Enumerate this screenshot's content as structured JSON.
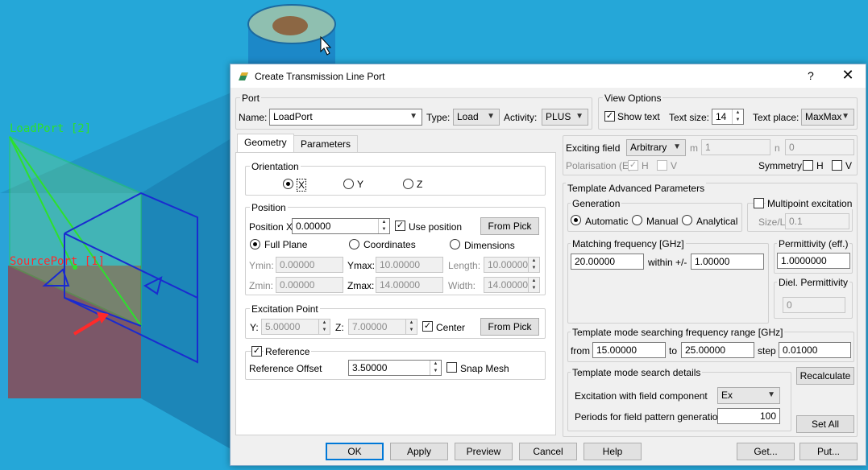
{
  "viewport": {
    "load_port_label": "LoadPort [2]",
    "source_port_label": "SourcePort [1]"
  },
  "dialog": {
    "title": "Create Transmission Line Port",
    "help": "?",
    "close": "✕"
  },
  "port": {
    "group_title": "Port",
    "name_label": "Name:",
    "name_value": "LoadPort",
    "type_label": "Type:",
    "type_value": "Load",
    "activity_label": "Activity:",
    "activity_value": "PLUS"
  },
  "view_options": {
    "group_title": "View Options",
    "show_text_label": "Show text",
    "show_text_checked": true,
    "text_size_label": "Text size:",
    "text_size_value": "14",
    "text_place_label": "Text place:",
    "text_place_value": "MaxMax"
  },
  "tabs": [
    "Geometry",
    "Parameters"
  ],
  "orientation": {
    "group_title": "Orientation",
    "options": [
      "X",
      "Y",
      "Z"
    ],
    "selected": "X"
  },
  "position": {
    "group_title": "Position",
    "position_x_label": "Position X",
    "position_x_value": "0.00000",
    "use_position_label": "Use position",
    "from_pick_label": "From Pick",
    "modes": [
      "Full Plane",
      "Coordinates",
      "Dimensions"
    ],
    "selected_mode": "Full Plane",
    "ymin_label": "Ymin:",
    "ymin_value": "0.00000",
    "ymax_label": "Ymax:",
    "ymax_value": "10.00000",
    "length_label": "Length:",
    "length_value": "10.00000",
    "zmin_label": "Zmin:",
    "zmin_value": "0.00000",
    "zmax_label": "Zmax:",
    "zmax_value": "14.00000",
    "width_label": "Width:",
    "width_value": "14.00000"
  },
  "excitation_point": {
    "group_title": "Excitation Point",
    "y_label": "Y:",
    "y_value": "5.00000",
    "z_label": "Z:",
    "z_value": "7.00000",
    "center_label": "Center",
    "from_pick_label": "From Pick"
  },
  "reference": {
    "group_title": "Reference",
    "offset_label": "Reference Offset",
    "offset_value": "3.50000",
    "snap_mesh_label": "Snap Mesh"
  },
  "exciting": {
    "field_label": "Exciting field",
    "field_value": "Arbitrary",
    "m_label": "m",
    "m_value": "1",
    "n_label": "n",
    "n_value": "0",
    "polarisation_label": "Polarisation (E)",
    "h_label": "H",
    "v_label": "V",
    "symmetry_label": "Symmetry",
    "sym_h_label": "H",
    "sym_v_label": "V"
  },
  "template": {
    "group_title": "Template Advanced Parameters",
    "generation_title": "Generation",
    "generation_options": [
      "Automatic",
      "Manual",
      "Analytical"
    ],
    "generation_selected": "Automatic",
    "multipoint_label": "Multipoint excitation",
    "size_l_label": "Size/L",
    "size_l_value": "0.1",
    "matching_title": "Matching frequency [GHz]",
    "matching_value": "20.00000",
    "within_label": "within +/-",
    "within_value": "1.00000",
    "permittivity_title": "Permittivity (eff.)",
    "permittivity_value": "1.0000000",
    "diel_title": "Diel. Permittivity",
    "diel_value": "0",
    "range_title": "Template mode searching frequency range [GHz]",
    "from_label": "from",
    "from_value": "15.00000",
    "to_label": "to",
    "to_value": "25.00000",
    "step_label": "step",
    "step_value": "0.01000",
    "search_title": "Template mode search details",
    "excitation_component_label": "Excitation with field component",
    "excitation_component_value": "Ex",
    "periods_label": "Periods for field pattern generation",
    "periods_value": "100",
    "recalculate_label": "Recalculate",
    "set_all_label": "Set All"
  },
  "footer": {
    "ok": "OK",
    "apply": "Apply",
    "preview": "Preview",
    "cancel": "Cancel",
    "help": "Help",
    "get": "Get...",
    "put": "Put..."
  },
  "colors": {
    "viewport_bg": "#25a7d8",
    "wireframe_green": "#2de02d",
    "wireframe_blue": "#1a2bd0",
    "source_face": "#8a4a55",
    "load_label": "#2de02d",
    "source_label": "#ff2a2a",
    "accent": "#0078d7"
  }
}
